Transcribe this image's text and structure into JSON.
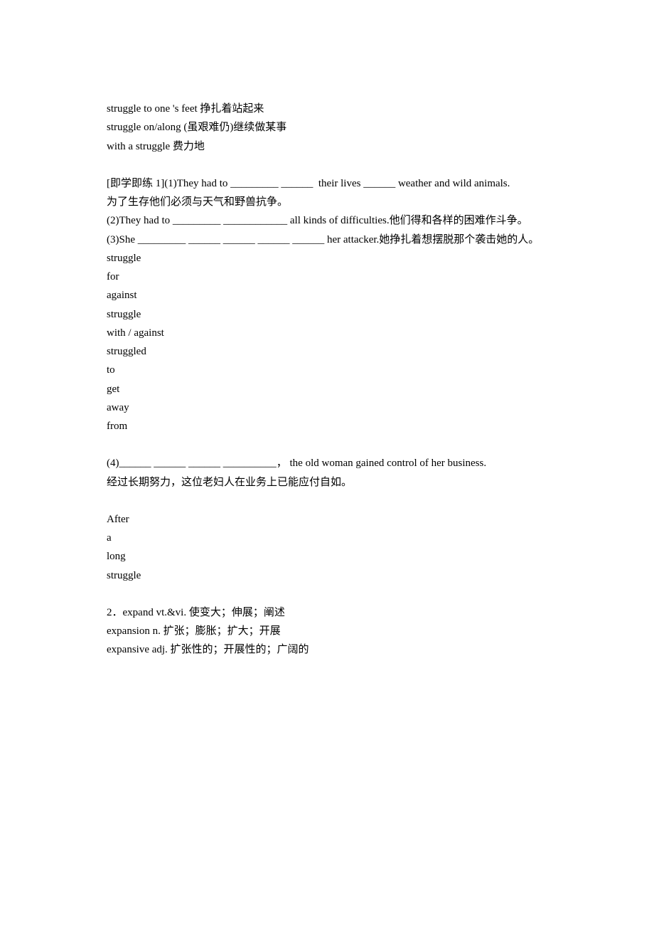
{
  "block1": {
    "line1": "struggle to one 's feet 挣扎着站起来",
    "line2": "struggle on/along (虽艰难仍)继续做某事",
    "line3": "with a struggle 费力地"
  },
  "block2": {
    "line1": "[即学即练 1](1)They had to _________ ______  their lives ______ weather and wild animals.",
    "line2": "为了生存他们必须与天气和野兽抗争。",
    "line3": "(2)They had to _________ ____________ all kinds of difficulties.他们得和各样的困难作斗争。",
    "line4": "(3)She _________ ______ ______ ______ ______ her attacker.她挣扎着想摆脱那个袭击她的人。",
    "line5": "struggle",
    "line6": "for",
    "line7": "against",
    "line8": "struggle",
    "line9": "with / against",
    "line10": "struggled",
    "line11": "to",
    "line12": "get",
    "line13": "away",
    "line14": "from"
  },
  "block3": {
    "line1": "(4)______ ______ ______ __________， the old woman gained control of her business.",
    "line2": "经过长期努力，这位老妇人在业务上已能应付自如。"
  },
  "block4": {
    "line1": "After",
    "line2": "a",
    "line3": "long",
    "line4": "struggle"
  },
  "block5": {
    "line1": "2．expand vt.&vi. 使变大；伸展；阐述",
    "line2": "expansion n. 扩张；膨胀；扩大；开展",
    "line3": "expansive adj. 扩张性的；开展性的；广阔的"
  }
}
